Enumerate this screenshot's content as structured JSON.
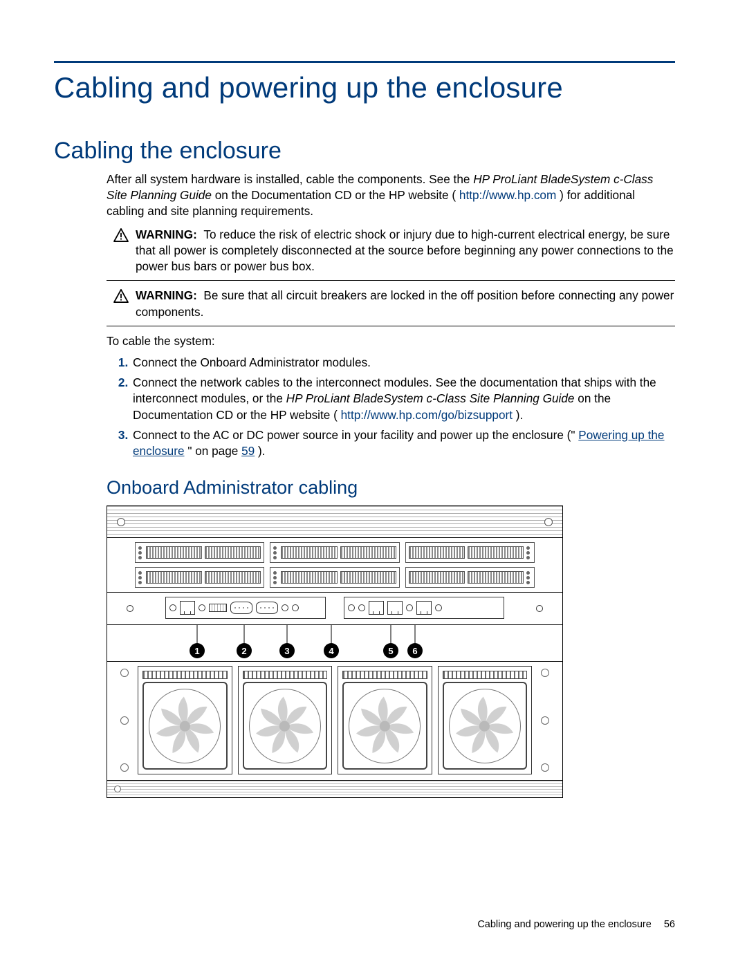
{
  "chapter_title": "Cabling and powering up the enclosure",
  "section_title": "Cabling the enclosure",
  "intro": {
    "lead": "After all system hardware is installed, cable the components. See the ",
    "doc_italic_1": "HP ProLiant BladeSystem c-Class Site Planning Guide",
    "mid": " on the Documentation CD or the HP website (",
    "link": "http://www.hp.com",
    "tail": ") for additional cabling and site planning requirements."
  },
  "warnings": [
    {
      "label": "WARNING:",
      "text": "To reduce the risk of electric shock or injury due to high-current electrical energy, be sure that all power is completely disconnected at the source before beginning any power connections to the power bus bars or power bus box."
    },
    {
      "label": "WARNING:",
      "text": "Be sure that all circuit breakers are locked in the off position before connecting any power components."
    }
  ],
  "lead_in": "To cable the system:",
  "steps": [
    {
      "full": "Connect the Onboard Administrator modules."
    },
    {
      "pre": "Connect the network cables to the interconnect modules. See the documentation that ships with the interconnect modules, or the ",
      "italic": "HP ProLiant BladeSystem c-Class Site Planning Guide",
      "mid": " on the Documentation CD or the HP website (",
      "link": "http://www.hp.com/go/bizsupport",
      "tail": ")."
    },
    {
      "pre": "Connect to the AC or DC power source in your facility and power up the enclosure (\"",
      "xref_text": "Powering up the enclosure",
      "mid2": "\" on page ",
      "xref_page": "59",
      "tail": ")."
    }
  ],
  "subsection_title": "Onboard Administrator cabling",
  "callout_numbers": [
    "1",
    "2",
    "3",
    "4",
    "5",
    "6"
  ],
  "footer": {
    "text": "Cabling and powering up the enclosure",
    "page": "56"
  }
}
